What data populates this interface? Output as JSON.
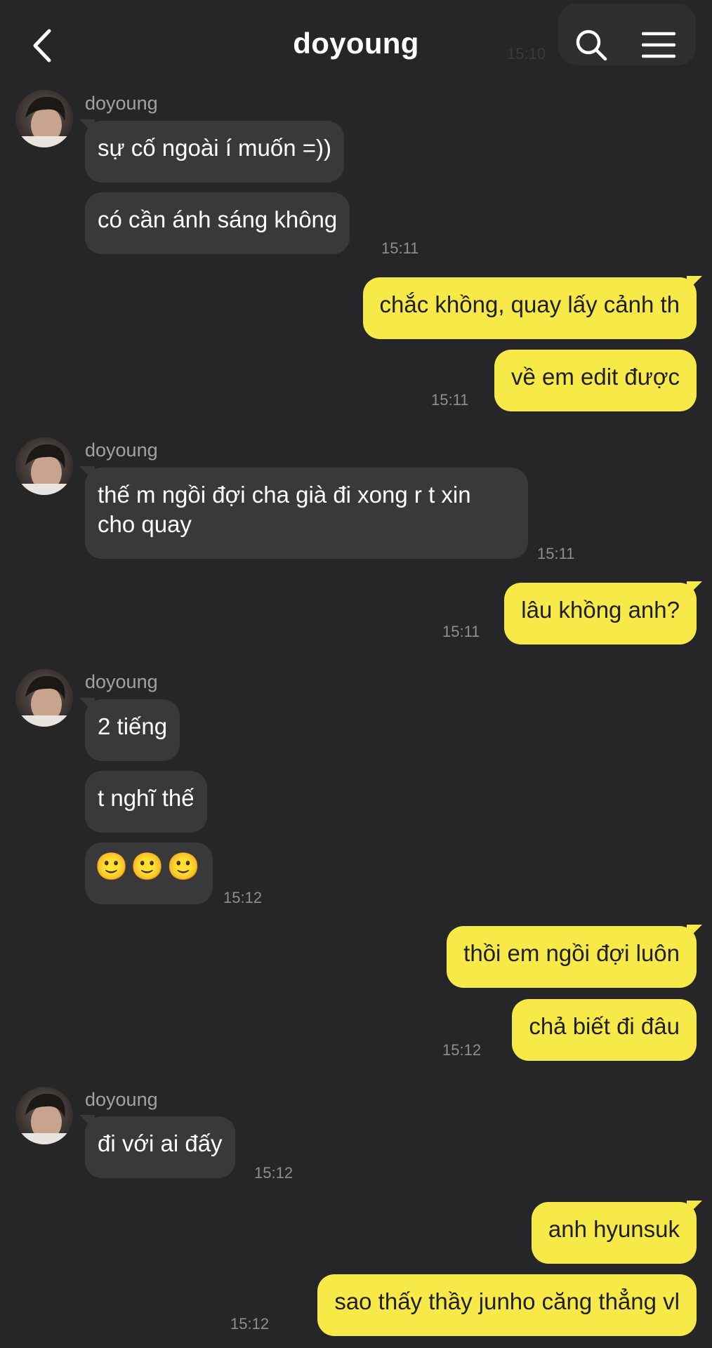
{
  "header": {
    "title": "doyoung",
    "ghost_time": "15:10"
  },
  "messages": [
    {
      "sender": "doyoung",
      "text": "sự cố ngoài í muốn =))"
    },
    {
      "text": "có cần ánh sáng không",
      "time": "15:11"
    },
    {
      "text": "chắc khồng, quay lấy cảnh th"
    },
    {
      "text": "về em edit được",
      "time": "15:11"
    },
    {
      "sender": "doyoung",
      "line1": "thế m ngồi đợi cha già đi xong r t xin",
      "line2": "cho quay",
      "time": "15:11"
    },
    {
      "text": "lâu khồng anh?",
      "time": "15:11"
    },
    {
      "sender": "doyoung",
      "text": "2 tiếng"
    },
    {
      "text": "t nghĩ thế"
    },
    {
      "emojis": [
        "🙂",
        "🙂",
        "🙂"
      ],
      "time": "15:12"
    },
    {
      "text": "thồi em ngồi đợi luôn"
    },
    {
      "text": "chả biết đi đâu",
      "time": "15:12"
    },
    {
      "sender": "doyoung",
      "text": "đi với ai đấy",
      "time": "15:12"
    },
    {
      "text": "anh hyunsuk"
    },
    {
      "text": "sao thấy thầy junho căng thẳng vl",
      "time": "15:12"
    }
  ],
  "colors": {
    "background": "#262628",
    "incoming_bubble": "#39393b",
    "outgoing_bubble": "#f7e948"
  },
  "icons": [
    "back-arrow-icon",
    "search-icon",
    "menu-icon",
    "avatar"
  ]
}
